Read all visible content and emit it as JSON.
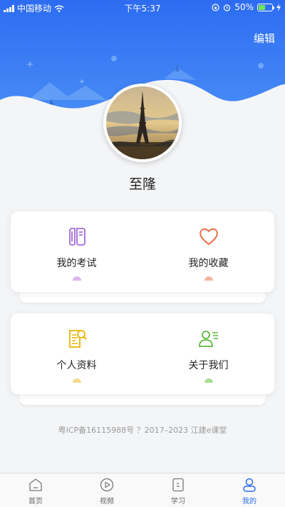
{
  "status_bar": {
    "carrier": "中国移动",
    "time": "下午5:37",
    "battery": "50%",
    "battery_level": 0.5
  },
  "header": {
    "edit_label": "编辑"
  },
  "profile": {
    "name": "至隆"
  },
  "cards": [
    {
      "items": [
        {
          "label": "我的考试",
          "icon": "exam-icon",
          "color": "#a46ad8",
          "dot_color": "#d8b6ee"
        },
        {
          "label": "我的收藏",
          "icon": "heart-icon",
          "color": "#e8704a",
          "dot_color": "#f4b4a0"
        }
      ]
    },
    {
      "items": [
        {
          "label": "个人资料",
          "icon": "profile-doc-icon",
          "color": "#e8b400",
          "dot_color": "#f6d98a"
        },
        {
          "label": "关于我们",
          "icon": "about-us-icon",
          "color": "#5ab83a",
          "dot_color": "#a8dc94"
        }
      ]
    }
  ],
  "footer": {
    "text": "粤ICP备16115988号 ？2017–2023 江建e课堂"
  },
  "tabs": [
    {
      "label": "首页",
      "icon": "home-icon",
      "active": false
    },
    {
      "label": "视频",
      "icon": "play-icon",
      "active": false
    },
    {
      "label": "学习",
      "icon": "study-icon",
      "active": false
    },
    {
      "label": "我的",
      "icon": "profile-icon",
      "active": true
    }
  ],
  "colors": {
    "header_blue": "#2f6ff0",
    "active_tab": "#2b6cf0"
  }
}
